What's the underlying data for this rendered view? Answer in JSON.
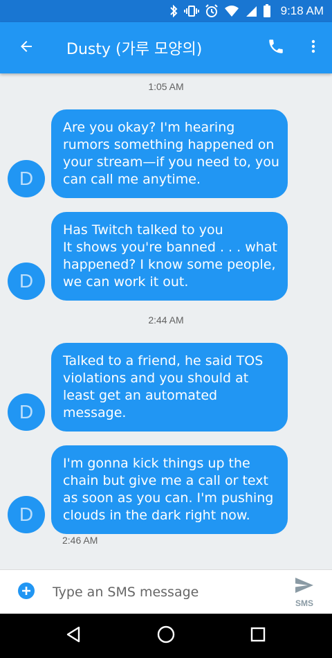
{
  "status_bar": {
    "time": "9:18 AM",
    "icons": [
      "bluetooth-icon",
      "vibrate-icon",
      "alarm-icon",
      "wifi-icon",
      "signal-icon",
      "battery-icon"
    ]
  },
  "app_bar": {
    "title": "Dusty (가루 모양의)",
    "icons": [
      "back-arrow-icon",
      "phone-icon",
      "more-vert-icon"
    ]
  },
  "messages": [
    {
      "type": "timestamp",
      "text": "1:05 AM"
    },
    {
      "type": "message",
      "avatar": "D",
      "lines": [
        "Are you okay? I'm hearing",
        "rumors something happened on",
        "your stream—if you need to, you",
        "can call me anytime."
      ]
    },
    {
      "type": "message",
      "avatar": "D",
      "lines": [
        "Has Twitch talked to you",
        "It shows you're banned . . . what",
        "happened? I know some people,",
        "we can work it out."
      ]
    },
    {
      "type": "timestamp",
      "text": "2:44 AM"
    },
    {
      "type": "message",
      "avatar": "D",
      "lines": [
        "Talked to a friend, he said TOS",
        "violations and you should at",
        "least get an automated",
        "message."
      ]
    },
    {
      "type": "message",
      "avatar": "D",
      "lines": [
        "I'm gonna kick things up the",
        "chain but give me a call or text",
        "as soon as you can. I'm pushing",
        "clouds in the dark right now."
      ]
    },
    {
      "type": "timestamp",
      "text": "2:46 AM"
    }
  ],
  "compose": {
    "placeholder": "Type an SMS message",
    "value": "",
    "send_label": "SMS"
  },
  "nav_bar": {
    "icons": [
      "back-triangle-icon",
      "home-circle-icon",
      "recents-square-icon"
    ]
  },
  "colors": {
    "primary": "#2196f3",
    "status_bar": "#1976d2",
    "background": "#eceff1"
  }
}
